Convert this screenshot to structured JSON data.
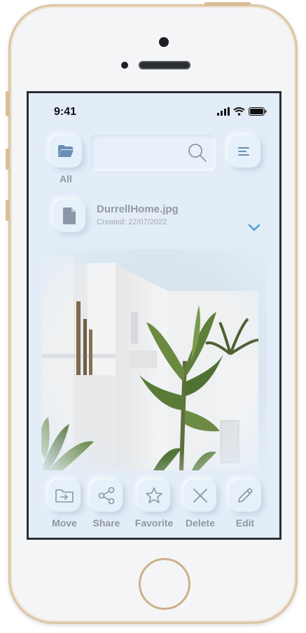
{
  "status_bar": {
    "time": "9:41"
  },
  "top_bar": {
    "folder_label": "All",
    "search": {
      "value": "",
      "placeholder": ""
    }
  },
  "file": {
    "name": "DurrellHome.jpg",
    "created": "Created: 22/07/2022"
  },
  "actions": [
    {
      "label": "Move",
      "icon": "move-to-folder-icon"
    },
    {
      "label": "Share",
      "icon": "share-icon"
    },
    {
      "label": "Favorite",
      "icon": "star-icon"
    },
    {
      "label": "Delete",
      "icon": "close-icon"
    },
    {
      "label": "Edit",
      "icon": "pencil-icon"
    }
  ],
  "colors": {
    "screen_bg": "#e3edf8",
    "icon_blue": "#6a8fb5",
    "label_gray": "#8e96a4",
    "chevron_blue": "#4aa3d8",
    "phone_gold": "#dcc6a6"
  }
}
